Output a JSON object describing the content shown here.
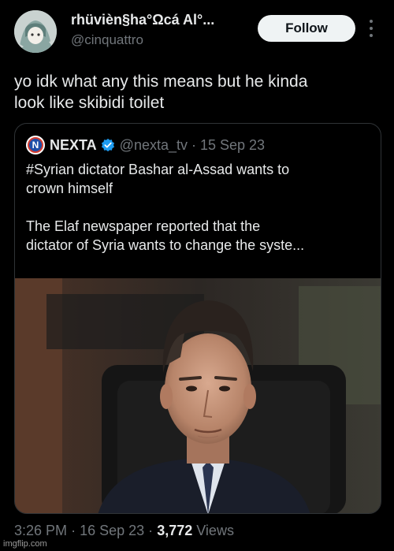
{
  "author": {
    "display_name": "rhüvièn§ha°Ωcá Al°...",
    "handle": "@cinquattro"
  },
  "follow_label": "Follow",
  "tweet_text": {
    "line1": "yo idk what any this means but he kinda",
    "line2": "look like skibidi toilet"
  },
  "quoted": {
    "logo_letter": "N",
    "name": "NEXTA",
    "handle": "@nexta_tv",
    "separator": "·",
    "date": "15 Sep 23",
    "text_line1": "#Syrian dictator Bashar al-Assad wants to",
    "text_line2": "crown himself",
    "text_line3": "The Elaf newspaper reported that the",
    "text_line4": "dictator of Syria wants to change the syste..."
  },
  "meta": {
    "time": "3:26 PM",
    "sep1": "·",
    "date": "16 Sep 23",
    "sep2": "·",
    "views_count": "3,772",
    "views_label": "Views"
  },
  "watermark": "imgflip.com",
  "colors": {
    "background": "#000000",
    "text_primary": "#e7e9ea",
    "text_secondary": "#71767b",
    "border": "#2f3336",
    "verified_blue": "#1d9bf0",
    "follow_bg": "#eff3f4"
  },
  "icons": [
    "more-options-icon",
    "verified-badge-icon",
    "nexta-logo-icon"
  ]
}
